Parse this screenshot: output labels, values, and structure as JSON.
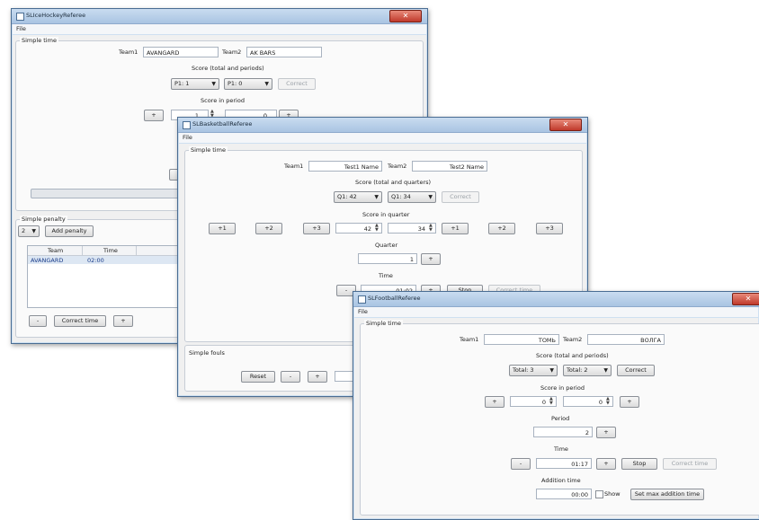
{
  "hockey": {
    "title": "SLIceHockeyReferee",
    "menu_file": "File",
    "simple_time": "Simple time",
    "team1_label": "Team1",
    "team1_value": "AVANGARD",
    "team2_label": "Team2",
    "team2_value": "AK BARS",
    "score_label": "Score (total and periods)",
    "combo1": "P1: 1",
    "combo2": "P1: 0",
    "correct": "Correct",
    "score_period_label": "Score in period",
    "plus": "+",
    "minus": "-",
    "score1": "1",
    "score2": "0",
    "simple_penalty": "Simple penalty",
    "penalty_combo": "2",
    "add_penalty": "Add penalty",
    "col_team": "Team",
    "col_time": "Time",
    "penalty_rows": [
      {
        "team": "AVANGARD",
        "time": "02:00"
      }
    ],
    "correct_time": "Correct time"
  },
  "basketball": {
    "title": "SLBasketballReferee",
    "menu_file": "File",
    "simple_time": "Simple time",
    "team1_label": "Team1",
    "team1_value": "Test1 Name",
    "team2_label": "Team2",
    "team2_value": "Test2 Name",
    "score_label": "Score (total and quarters)",
    "combo1": "Q1: 42",
    "combo2": "Q1: 34",
    "correct": "Correct",
    "score_quarter_label": "Score in quarter",
    "p1": "+1",
    "p2": "+2",
    "p3": "+3",
    "score1": "42",
    "score2": "34",
    "quarter_label": "Quarter",
    "quarter_value": "1",
    "plus": "+",
    "minus": "-",
    "time_label": "Time",
    "time_value": "01:02",
    "stop": "Stop",
    "correct_time": "Correct time",
    "simple_fouls": "Simple fouls",
    "reset": "Reset"
  },
  "football": {
    "title": "SLFootballReferee",
    "menu_file": "File",
    "simple_time": "Simple time",
    "team1_label": "Team1",
    "team1_value": "ТОМЬ",
    "team2_label": "Team2",
    "team2_value": "ВОЛГА",
    "score_label": "Score (total and periods)",
    "combo1": "Total: 3",
    "combo2": "Total: 2",
    "correct": "Correct",
    "score_period_label": "Score in period",
    "score1": "0",
    "score2": "0",
    "plus": "+",
    "minus": "-",
    "period_label": "Period",
    "period_value": "2",
    "time_label": "Time",
    "time_value": "01:17",
    "stop": "Stop",
    "correct_time": "Correct time",
    "addition_label": "Addition time",
    "addition_value": "00:00",
    "show_label": "Show",
    "set_max": "Set max addition time"
  }
}
